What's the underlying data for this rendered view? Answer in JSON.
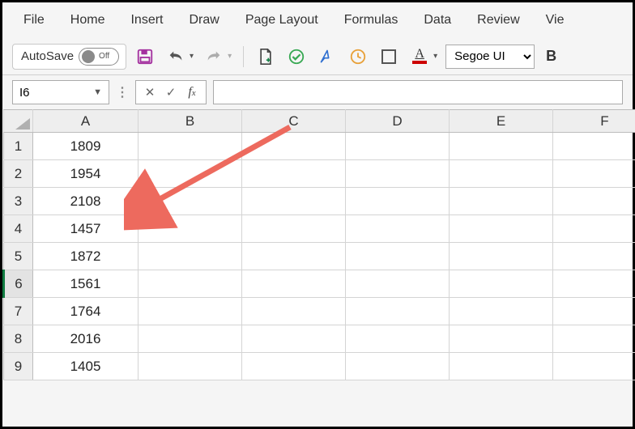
{
  "ribbon": {
    "tabs": [
      "File",
      "Home",
      "Insert",
      "Draw",
      "Page Layout",
      "Formulas",
      "Data",
      "Review",
      "Vie"
    ]
  },
  "toolbar": {
    "autosave_label": "AutoSave",
    "autosave_state": "Off",
    "font_name": "Segoe UI",
    "bold_label": "B"
  },
  "namebox": {
    "value": "I6"
  },
  "formula_bar": {
    "value": ""
  },
  "grid": {
    "columns": [
      "A",
      "B",
      "C",
      "D",
      "E",
      "F"
    ],
    "rows": [
      {
        "n": "1",
        "A": "1809"
      },
      {
        "n": "2",
        "A": "1954"
      },
      {
        "n": "3",
        "A": "2108"
      },
      {
        "n": "4",
        "A": "1457"
      },
      {
        "n": "5",
        "A": "1872"
      },
      {
        "n": "6",
        "A": "1561"
      },
      {
        "n": "7",
        "A": "1764"
      },
      {
        "n": "8",
        "A": "2016"
      },
      {
        "n": "9",
        "A": "1405"
      }
    ],
    "active_row": 6
  },
  "chart_data": {
    "type": "table",
    "columns": [
      "A"
    ],
    "data": [
      [
        "1809"
      ],
      [
        "1954"
      ],
      [
        "2108"
      ],
      [
        "1457"
      ],
      [
        "1872"
      ],
      [
        "1561"
      ],
      [
        "1764"
      ],
      [
        "2016"
      ],
      [
        "1405"
      ]
    ]
  },
  "annotation": {
    "color": "#ed6a5e"
  }
}
